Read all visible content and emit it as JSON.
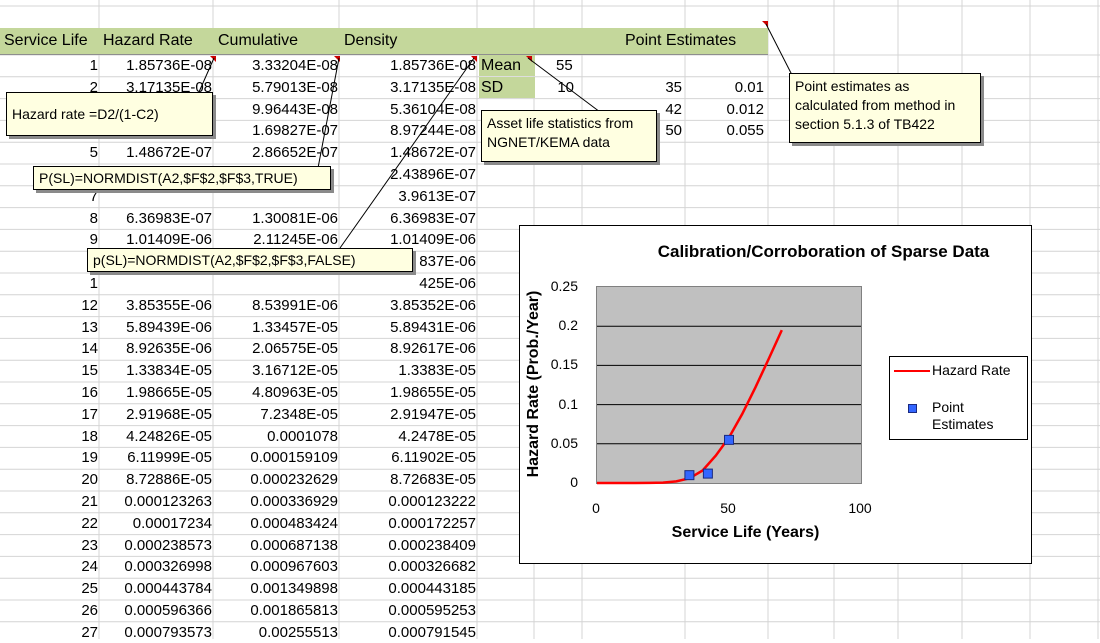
{
  "sheet": {
    "headers": {
      "service_life": "Service Life",
      "hazard_rate": "Hazard Rate",
      "cumulative": "Cumulative",
      "density": "Density",
      "point_estimates": "Point Estimates"
    },
    "rows": [
      {
        "n": "1",
        "h": "1.85736E-08",
        "c": "3.33204E-08",
        "d": "1.85736E-08"
      },
      {
        "n": "2",
        "h": "3.17135E-08",
        "c": "5.79013E-08",
        "d": "3.17135E-08"
      },
      {
        "n": "3",
        "h": "",
        "c": "9.96443E-08",
        "d": "5.36104E-08"
      },
      {
        "n": "4",
        "h": "",
        "c": "1.69827E-07",
        "d": "8.97244E-08"
      },
      {
        "n": "5",
        "h": "1.48672E-07",
        "c": "2.86652E-07",
        "d": "1.48672E-07"
      },
      {
        "n": "6",
        "h": "",
        "c": "",
        "d": "2.43896E-07"
      },
      {
        "n": "7",
        "h": "",
        "c": "",
        "d": "3.9613E-07"
      },
      {
        "n": "8",
        "h": "6.36983E-07",
        "c": "1.30081E-06",
        "d": "6.36983E-07"
      },
      {
        "n": "9",
        "h": "1.01409E-06",
        "c": "2.11245E-06",
        "d": "1.01409E-06"
      },
      {
        "n": "1",
        "h": "",
        "c": "",
        "d": "837E-06"
      },
      {
        "n": "1",
        "h": "",
        "c": "",
        "d": "425E-06"
      },
      {
        "n": "12",
        "h": "3.85355E-06",
        "c": "8.53991E-06",
        "d": "3.85352E-06"
      },
      {
        "n": "13",
        "h": "5.89439E-06",
        "c": "1.33457E-05",
        "d": "5.89431E-06"
      },
      {
        "n": "14",
        "h": "8.92635E-06",
        "c": "2.06575E-05",
        "d": "8.92617E-06"
      },
      {
        "n": "15",
        "h": "1.33834E-05",
        "c": "3.16712E-05",
        "d": "1.3383E-05"
      },
      {
        "n": "16",
        "h": "1.98665E-05",
        "c": "4.80963E-05",
        "d": "1.98655E-05"
      },
      {
        "n": "17",
        "h": "2.91968E-05",
        "c": "7.2348E-05",
        "d": "2.91947E-05"
      },
      {
        "n": "18",
        "h": "4.24826E-05",
        "c": "0.0001078",
        "d": "4.2478E-05"
      },
      {
        "n": "19",
        "h": "6.11999E-05",
        "c": "0.000159109",
        "d": "6.11902E-05"
      },
      {
        "n": "20",
        "h": "8.72886E-05",
        "c": "0.000232629",
        "d": "8.72683E-05"
      },
      {
        "n": "21",
        "h": "0.000123263",
        "c": "0.000336929",
        "d": "0.000123222"
      },
      {
        "n": "22",
        "h": "0.00017234",
        "c": "0.000483424",
        "d": "0.000172257"
      },
      {
        "n": "23",
        "h": "0.000238573",
        "c": "0.000687138",
        "d": "0.000238409"
      },
      {
        "n": "24",
        "h": "0.000326998",
        "c": "0.000967603",
        "d": "0.000326682"
      },
      {
        "n": "25",
        "h": "0.000443784",
        "c": "0.001349898",
        "d": "0.000443185"
      },
      {
        "n": "26",
        "h": "0.000596366",
        "c": "0.001865813",
        "d": "0.000595253"
      },
      {
        "n": "27",
        "h": "0.000793573",
        "c": "0.00255513",
        "d": "0.000791545"
      }
    ],
    "stats": {
      "mean_label": "Mean",
      "mean_value": "55",
      "sd_label": "SD",
      "sd_value": "10"
    },
    "point_estimates": [
      {
        "life": "35",
        "rate": "0.01"
      },
      {
        "life": "42",
        "rate": "0.012"
      },
      {
        "life": "50",
        "rate": "0.055"
      }
    ]
  },
  "notes": {
    "hazard_formula": "Hazard rate =D2/(1-C2)",
    "cdf_formula": "P(SL)=NORMDIST(A2,$F$2,$F$3,TRUE)",
    "pdf_formula": "p(SL)=NORMDIST(A2,$F$2,$F$3,FALSE)",
    "asset_stats": [
      "Asset life statistics from",
      "NGNET/KEMA data"
    ],
    "point_estimates": [
      "Point estimates as",
      "calculated from method in",
      "section 5.1.3 of TB422"
    ]
  },
  "chart_data": {
    "type": "line",
    "title": "Calibration/Corroboration of Sparse Data",
    "xlabel": "Service Life (Years)",
    "ylabel": "Hazard Rate (Prob./Year)",
    "xlim": [
      0,
      100
    ],
    "ylim": [
      0,
      0.25
    ],
    "x_ticks": [
      "0",
      "50",
      "100"
    ],
    "y_ticks": [
      "0",
      "0.05",
      "0.1",
      "0.15",
      "0.2",
      "0.25"
    ],
    "grid": true,
    "legend": "right",
    "series": [
      {
        "name": "Hazard Rate",
        "kind": "line",
        "color": "#ff0000",
        "x": [
          0,
          10,
          20,
          25,
          30,
          35,
          40,
          45,
          50,
          55,
          60,
          65,
          70
        ],
        "y": [
          0,
          0,
          0.0001,
          0.0005,
          0.002,
          0.006,
          0.016,
          0.035,
          0.058,
          0.088,
          0.122,
          0.158,
          0.195
        ]
      },
      {
        "name": "Point Estimates",
        "kind": "scatter",
        "color": "#3366ff",
        "x": [
          35,
          42,
          50
        ],
        "y": [
          0.01,
          0.012,
          0.055
        ]
      }
    ]
  }
}
